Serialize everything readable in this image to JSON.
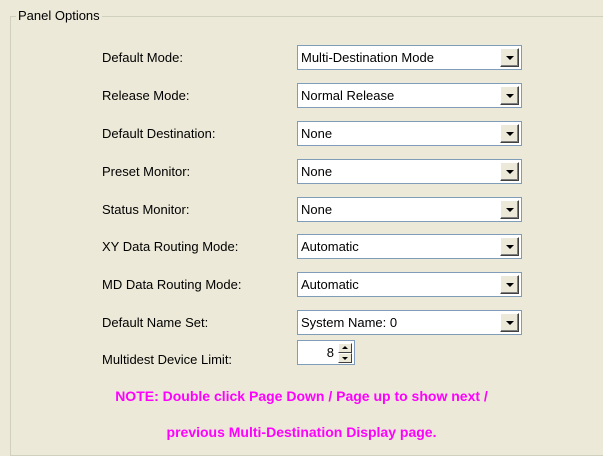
{
  "panel": {
    "title": "Panel Options"
  },
  "fields": [
    {
      "label": "Default Mode:",
      "value": "Multi-Destination Mode"
    },
    {
      "label": "Release Mode:",
      "value": "Normal Release"
    },
    {
      "label": "Default Destination:",
      "value": "None"
    },
    {
      "label": "Preset Monitor:",
      "value": "None"
    },
    {
      "label": "Status Monitor:",
      "value": "None"
    },
    {
      "label": "XY Data Routing Mode:",
      "value": "Automatic"
    },
    {
      "label": "MD Data Routing Mode:",
      "value": "Automatic"
    },
    {
      "label": "Default Name Set:",
      "value": "System Name: 0"
    }
  ],
  "spinner": {
    "label": "Multidest Device Limit:",
    "value": "8"
  },
  "note": {
    "line1": "NOTE: Double click Page Down / Page up to show next /",
    "line2": "previous Multi-Destination Display page.",
    "color": "#ff00ff"
  },
  "icons": {
    "dropdown": "chevron-down-icon",
    "spin_up": "arrow-up-icon",
    "spin_down": "arrow-down-icon"
  }
}
